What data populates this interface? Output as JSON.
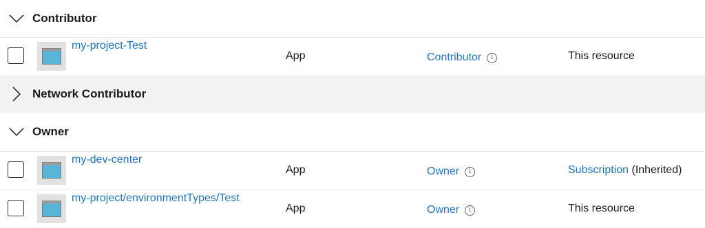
{
  "groups": [
    {
      "label": "Contributor",
      "expanded": true,
      "rows": [
        {
          "name": "my-project-Test",
          "type": "App",
          "role": "Contributor",
          "scope": "This resource",
          "scope_link": "",
          "scope_suffix": "This resource"
        }
      ]
    },
    {
      "label": "Network Contributor",
      "expanded": false,
      "rows": []
    },
    {
      "label": "Owner",
      "expanded": true,
      "rows": [
        {
          "name": "my-dev-center",
          "type": "App",
          "role": "Owner",
          "scope_link": "Subscription",
          "scope_suffix": " (Inherited)"
        },
        {
          "name": "my-project/environmentTypes/Test",
          "type": "App",
          "role": "Owner",
          "scope_link": "",
          "scope_suffix": "This resource"
        }
      ]
    }
  ],
  "icons": {
    "expanded": "chevron-down-icon",
    "collapsed": "chevron-right-icon",
    "app": "app-registration-icon",
    "info": "info-icon"
  },
  "colors": {
    "link": "#1a74c7",
    "collapsed_header_bg": "#f3f2f1",
    "text": "#1b1b1b"
  }
}
